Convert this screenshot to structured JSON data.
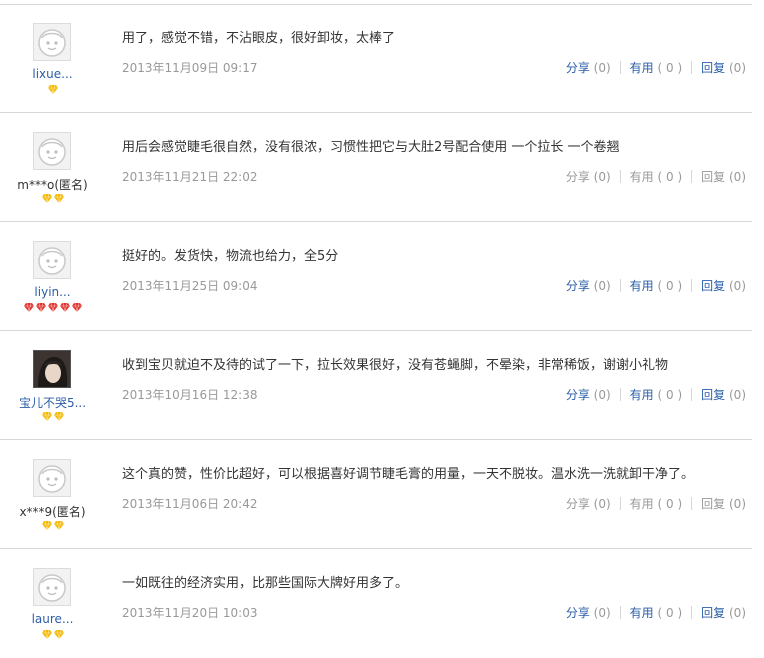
{
  "reviews": [
    {
      "username": "lixue...",
      "name_style": "link",
      "avatar": "default-avatar",
      "badge": {
        "type": "diamond-yellow",
        "count": 1
      },
      "content": "用了，感觉不错，不沾眼皮，很好卸妆，太棒了",
      "date": "2013年11月09日 09:17",
      "share_label": "分享",
      "share_count": "(0)",
      "useful_label": "有用",
      "useful_count": "( 0 )",
      "reply_label": "回复",
      "reply_count": "(0)",
      "active": true
    },
    {
      "username": "m***o(匿名)",
      "name_style": "anon",
      "avatar": "default-avatar",
      "badge": {
        "type": "diamond-yellow",
        "count": 2
      },
      "content": "用后会感觉睫毛很自然，没有很浓，习惯性把它与大肚2号配合使用 一个拉长 一个卷翘",
      "date": "2013年11月21日 22:02",
      "share_label": "分享",
      "share_count": "(0)",
      "useful_label": "有用",
      "useful_count": "( 0 )",
      "reply_label": "回复",
      "reply_count": "(0)",
      "active": false
    },
    {
      "username": "liyin...",
      "name_style": "link",
      "avatar": "default-avatar",
      "badge": {
        "type": "diamond-red",
        "count": 5
      },
      "content": "挺好的。发货快，物流也给力，全5分",
      "date": "2013年11月25日 09:04",
      "share_label": "分享",
      "share_count": "(0)",
      "useful_label": "有用",
      "useful_count": "( 0 )",
      "reply_label": "回复",
      "reply_count": "(0)",
      "active": true
    },
    {
      "username": "宝儿不哭5...",
      "name_style": "link",
      "avatar": "photo-avatar",
      "badge": {
        "type": "diamond-yellow",
        "count": 2
      },
      "content": "收到宝贝就迫不及待的试了一下，拉长效果很好，没有苍蝇脚，不晕染，非常稀饭，谢谢小礼物",
      "date": "2013年10月16日 12:38",
      "share_label": "分享",
      "share_count": "(0)",
      "useful_label": "有用",
      "useful_count": "( 0 )",
      "reply_label": "回复",
      "reply_count": "(0)",
      "active": true
    },
    {
      "username": "x***9(匿名)",
      "name_style": "anon",
      "avatar": "default-avatar",
      "badge": {
        "type": "diamond-yellow",
        "count": 2
      },
      "content": "这个真的赞，性价比超好，可以根据喜好调节睫毛膏的用量，一天不脱妆。温水洗一洗就卸干净了。",
      "date": "2013年11月06日 20:42",
      "share_label": "分享",
      "share_count": "(0)",
      "useful_label": "有用",
      "useful_count": "( 0 )",
      "reply_label": "回复",
      "reply_count": "(0)",
      "active": false
    },
    {
      "username": "laure...",
      "name_style": "link",
      "avatar": "default-avatar",
      "badge": {
        "type": "diamond-yellow",
        "count": 2
      },
      "content": "一如既往的经济实用，比那些国际大牌好用多了。",
      "date": "2013年11月20日 10:03",
      "share_label": "分享",
      "share_count": "(0)",
      "useful_label": "有用",
      "useful_count": "( 0 )",
      "reply_label": "回复",
      "reply_count": "(0)",
      "active": true
    }
  ],
  "colors": {
    "link": "#2b5ea8",
    "muted": "#999999",
    "text": "#333333",
    "divider": "#d7d7d7",
    "diamond_yellow": "#f5b800",
    "diamond_red": "#e0322d"
  }
}
